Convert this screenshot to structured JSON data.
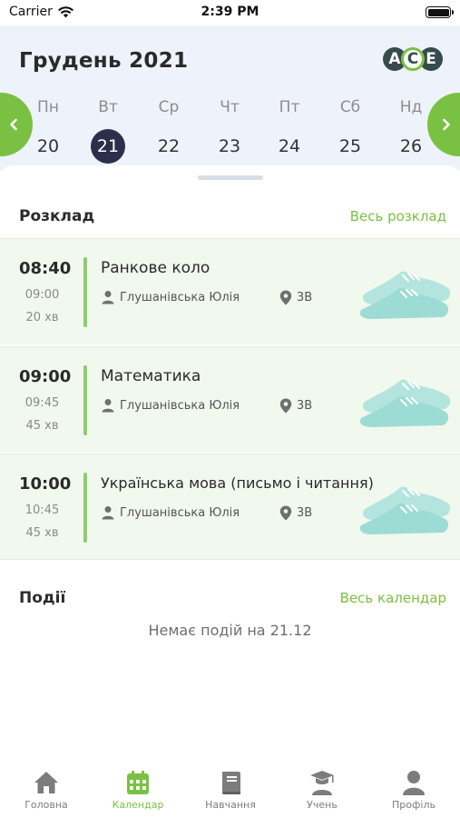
{
  "status_bar": {
    "carrier": "Carrier",
    "time": "2:39 PM"
  },
  "header": {
    "month": "Грудень 2021",
    "logo": {
      "letters": [
        "A",
        "C",
        "E"
      ]
    },
    "week": [
      {
        "name": "Пн",
        "date": "20"
      },
      {
        "name": "Вт",
        "date": "21",
        "selected": true
      },
      {
        "name": "Ср",
        "date": "22"
      },
      {
        "name": "Чт",
        "date": "23"
      },
      {
        "name": "Пт",
        "date": "24"
      },
      {
        "name": "Сб",
        "date": "25"
      },
      {
        "name": "Нд",
        "date": "26"
      }
    ],
    "prev_icon": "chevron-left-icon",
    "next_icon": "chevron-right-icon"
  },
  "schedule": {
    "title": "Розклад",
    "link": "Весь розклад",
    "lessons": [
      {
        "start": "08:40",
        "end": "09:00",
        "duration": "20 хв",
        "subject": "Ранкове коло",
        "teacher": "Глушанівська Юлія",
        "room": "3В"
      },
      {
        "start": "09:00",
        "end": "09:45",
        "duration": "45 хв",
        "subject": "Математика",
        "teacher": "Глушанівська Юлія",
        "room": "3В"
      },
      {
        "start": "10:00",
        "end": "10:45",
        "duration": "45 хв",
        "subject": "Українська мова (письмо і читання)",
        "teacher": "Глушанівська Юлія",
        "room": "3В"
      }
    ]
  },
  "events": {
    "title": "Події",
    "link": "Весь календар",
    "empty": "Немає подій на 21.12"
  },
  "tabbar": {
    "items": [
      {
        "label": "Головна",
        "icon": "home-icon"
      },
      {
        "label": "Календар",
        "icon": "calendar-icon",
        "active": true
      },
      {
        "label": "Навчання",
        "icon": "book-icon"
      },
      {
        "label": "Учень",
        "icon": "student-icon"
      },
      {
        "label": "Профіль",
        "icon": "profile-icon"
      }
    ]
  },
  "colors": {
    "accent": "#7ac143",
    "header_bg": "#eef2fb",
    "selected_day": "#2c2f4b",
    "lesson_bg": "#f1f8ee"
  }
}
